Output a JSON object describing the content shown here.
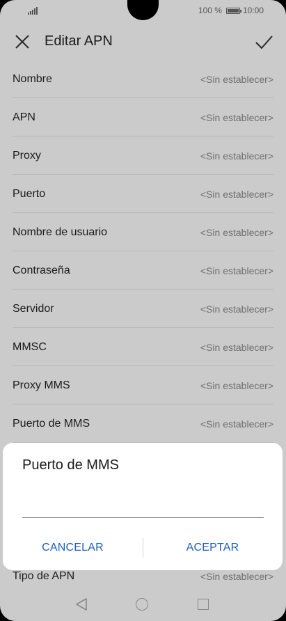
{
  "status_bar": {
    "battery_percent": "100 %",
    "time": "10:00"
  },
  "header": {
    "title": "Editar APN",
    "close_icon": "close-icon",
    "confirm_icon": "check-icon"
  },
  "fields": [
    {
      "label": "Nombre",
      "value": "<Sin establecer>"
    },
    {
      "label": "APN",
      "value": "<Sin establecer>"
    },
    {
      "label": "Proxy",
      "value": "<Sin establecer>"
    },
    {
      "label": "Puerto",
      "value": "<Sin establecer>"
    },
    {
      "label": "Nombre de usuario",
      "value": "<Sin establecer>"
    },
    {
      "label": "Contraseña",
      "value": "<Sin establecer>"
    },
    {
      "label": "Servidor",
      "value": "<Sin establecer>"
    },
    {
      "label": "MMSC",
      "value": "<Sin establecer>"
    },
    {
      "label": "Proxy MMS",
      "value": "<Sin establecer>"
    },
    {
      "label": "Puerto de MMS",
      "value": "<Sin establecer>"
    }
  ],
  "tipo_apn": {
    "label": "Tipo de APN",
    "value": "<Sin establecer>"
  },
  "dialog": {
    "title": "Puerto de MMS",
    "input_value": "",
    "cancel_label": "CANCELAR",
    "accept_label": "ACEPTAR"
  },
  "colors": {
    "dim_background": "#cbcbcb",
    "accent": "#1d5fb8"
  }
}
